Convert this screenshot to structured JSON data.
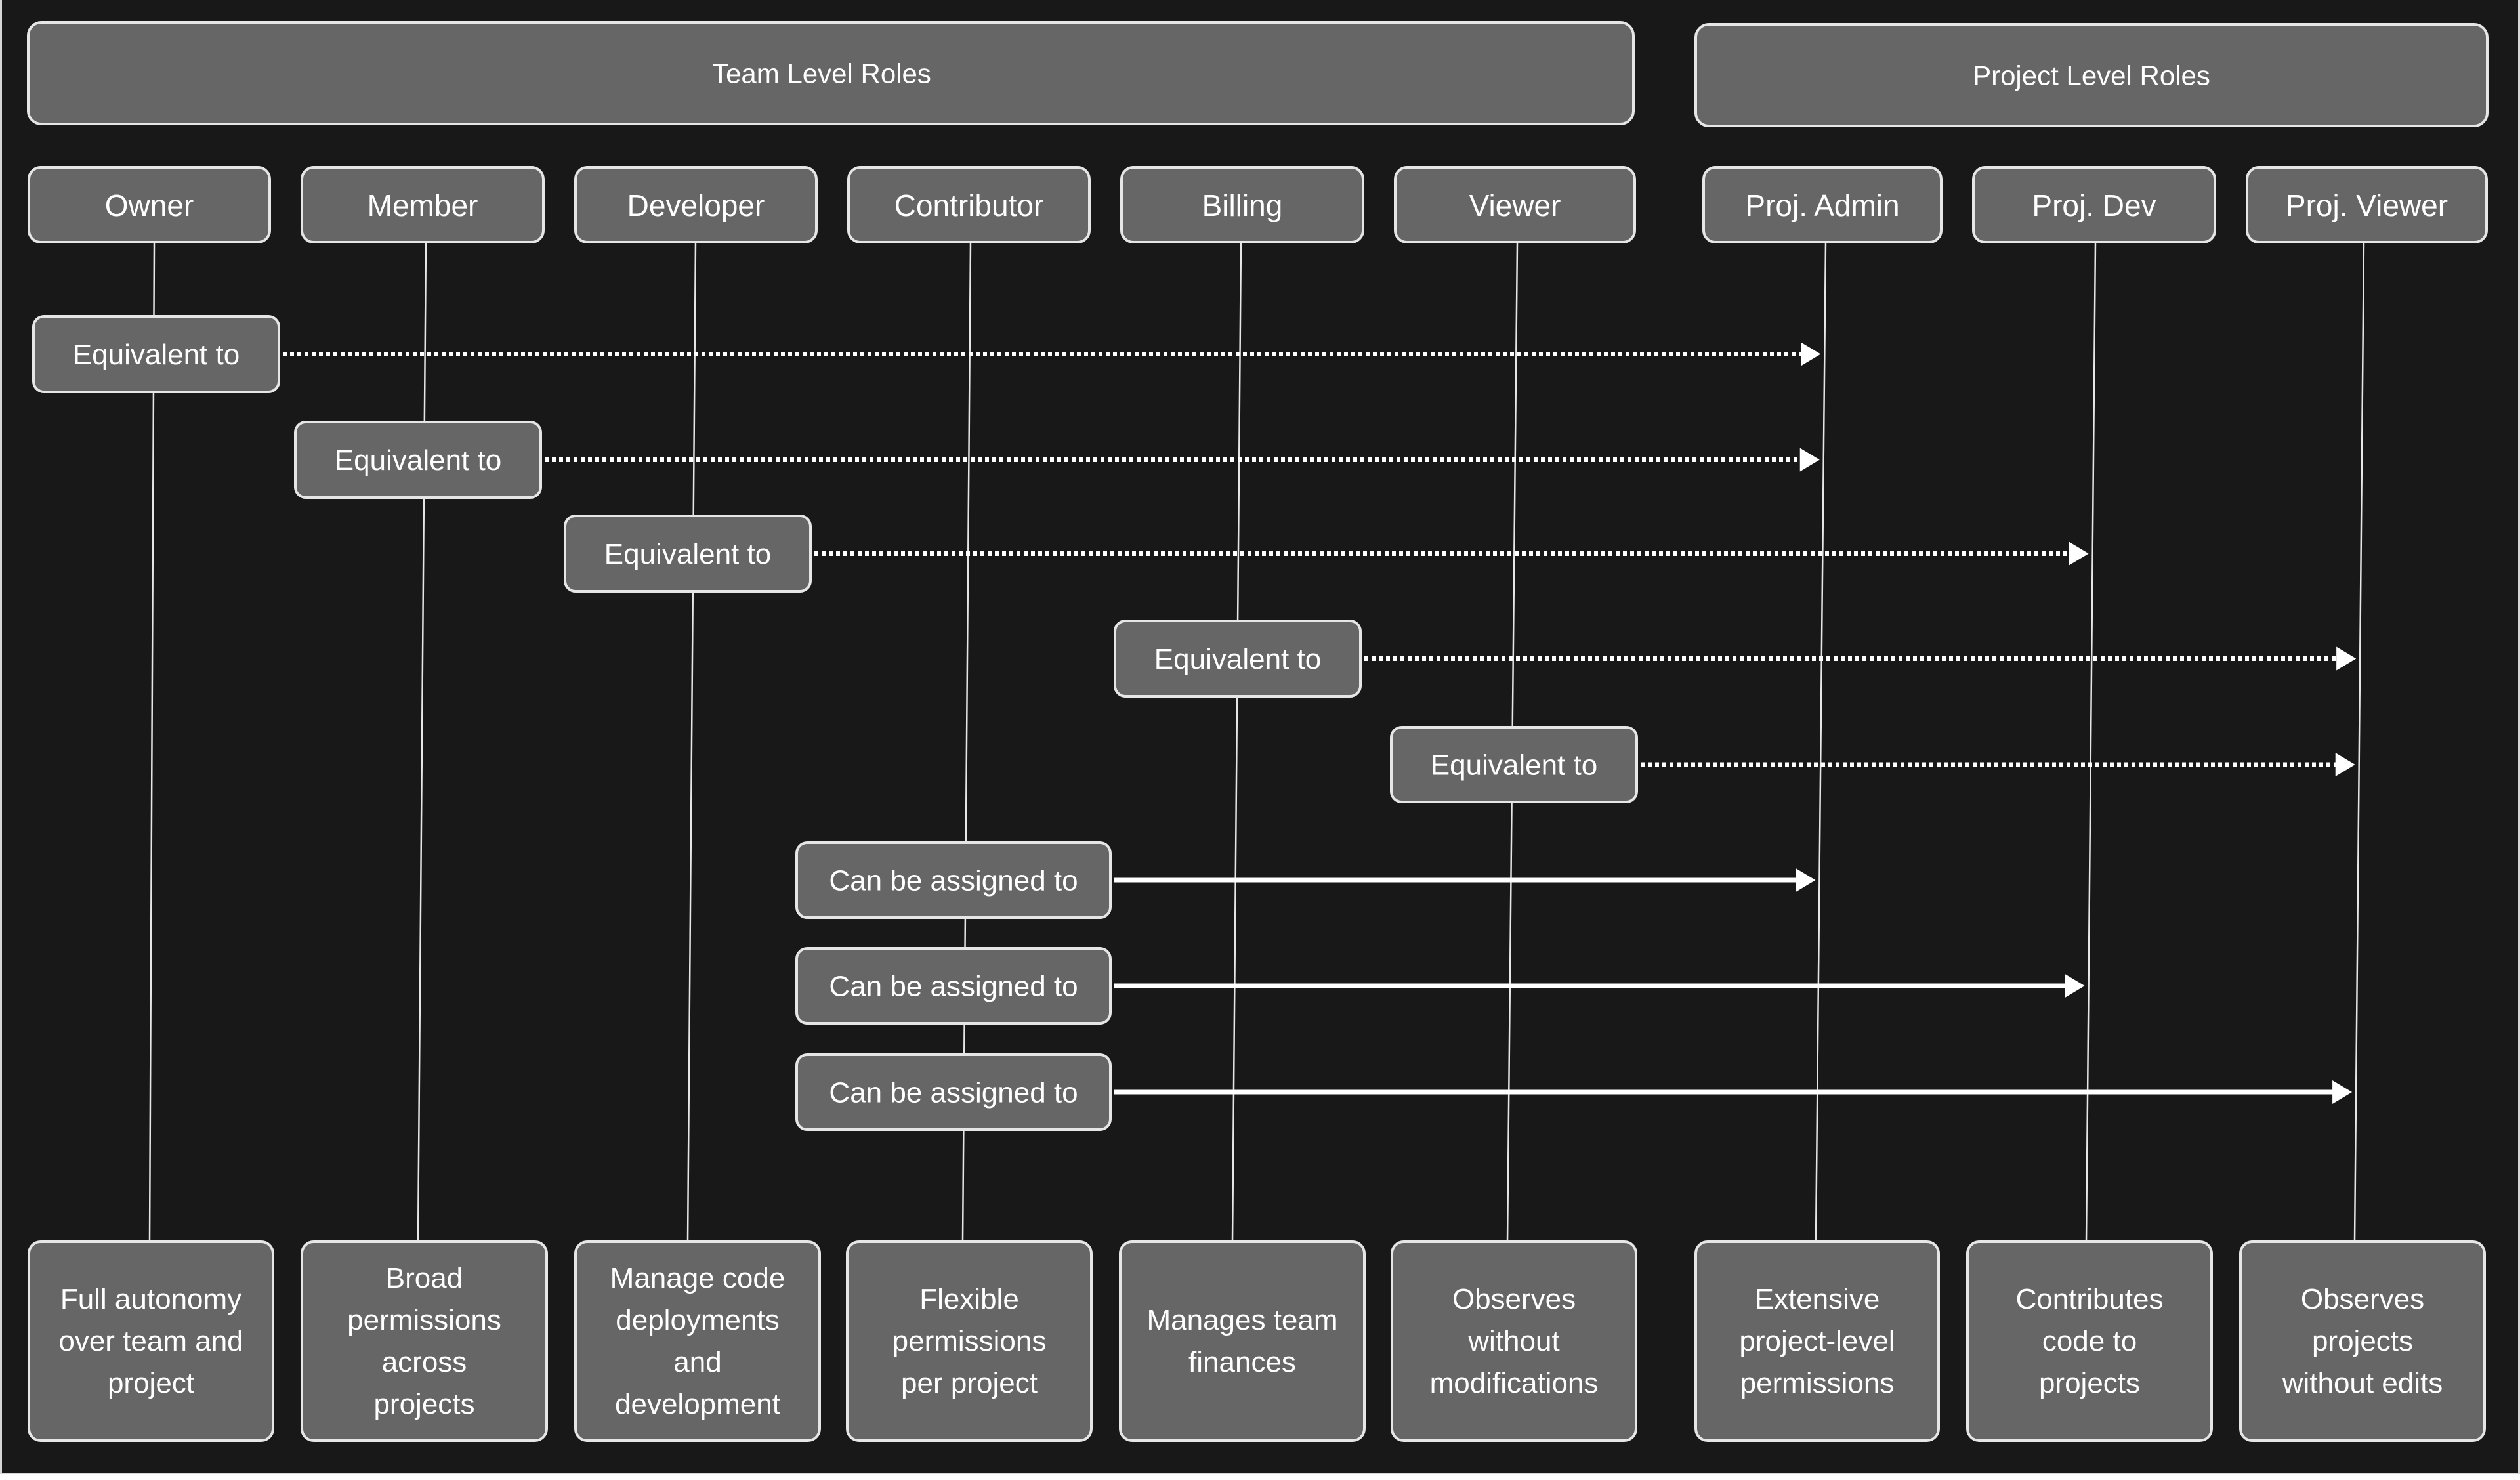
{
  "groups": [
    {
      "id": "team",
      "label": "Team Level Roles"
    },
    {
      "id": "project",
      "label": "Project Level Roles"
    }
  ],
  "roles": [
    {
      "id": "owner",
      "label": "Owner",
      "group": "team",
      "description": [
        "Full autonomy",
        "over team and",
        "project"
      ]
    },
    {
      "id": "member",
      "label": "Member",
      "group": "team",
      "description": [
        "Broad",
        "permissions",
        "across",
        "projects"
      ]
    },
    {
      "id": "developer",
      "label": "Developer",
      "group": "team",
      "description": [
        "Manage code",
        "deployments",
        "and",
        "development"
      ]
    },
    {
      "id": "contributor",
      "label": "Contributor",
      "group": "team",
      "description": [
        "Flexible",
        "permissions",
        "per project"
      ]
    },
    {
      "id": "billing",
      "label": "Billing",
      "group": "team",
      "description": [
        "Manages team",
        "finances"
      ]
    },
    {
      "id": "viewer",
      "label": "Viewer",
      "group": "team",
      "description": [
        "Observes",
        "without",
        "modifications"
      ]
    },
    {
      "id": "proj-admin",
      "label": "Proj. Admin",
      "group": "project",
      "description": [
        "Extensive",
        "project-level",
        "permissions"
      ]
    },
    {
      "id": "proj-dev",
      "label": "Proj. Dev",
      "group": "project",
      "description": [
        "Contributes",
        "code to",
        "projects"
      ]
    },
    {
      "id": "proj-viewer",
      "label": "Proj. Viewer",
      "group": "project",
      "description": [
        "Observes",
        "projects",
        "without edits"
      ]
    }
  ],
  "relations": [
    {
      "from": "owner",
      "to": "proj-admin",
      "label": "Equivalent to",
      "style": "dotted"
    },
    {
      "from": "member",
      "to": "proj-admin",
      "label": "Equivalent to",
      "style": "dotted"
    },
    {
      "from": "developer",
      "to": "proj-dev",
      "label": "Equivalent to",
      "style": "dotted"
    },
    {
      "from": "billing",
      "to": "proj-viewer",
      "label": "Equivalent to",
      "style": "dotted"
    },
    {
      "from": "viewer",
      "to": "proj-viewer",
      "label": "Equivalent to",
      "style": "dotted"
    },
    {
      "from": "contributor",
      "to": "proj-admin",
      "label": "Can be assigned to",
      "style": "solid"
    },
    {
      "from": "contributor",
      "to": "proj-dev",
      "label": "Can be assigned to",
      "style": "solid"
    },
    {
      "from": "contributor",
      "to": "proj-viewer",
      "label": "Can be assigned to",
      "style": "solid"
    }
  ],
  "colors": {
    "background": "#181818",
    "box_fill": "#666666",
    "box_stroke": "#e6e6e6",
    "text": "#ffffff",
    "arrow": "#ffffff"
  }
}
